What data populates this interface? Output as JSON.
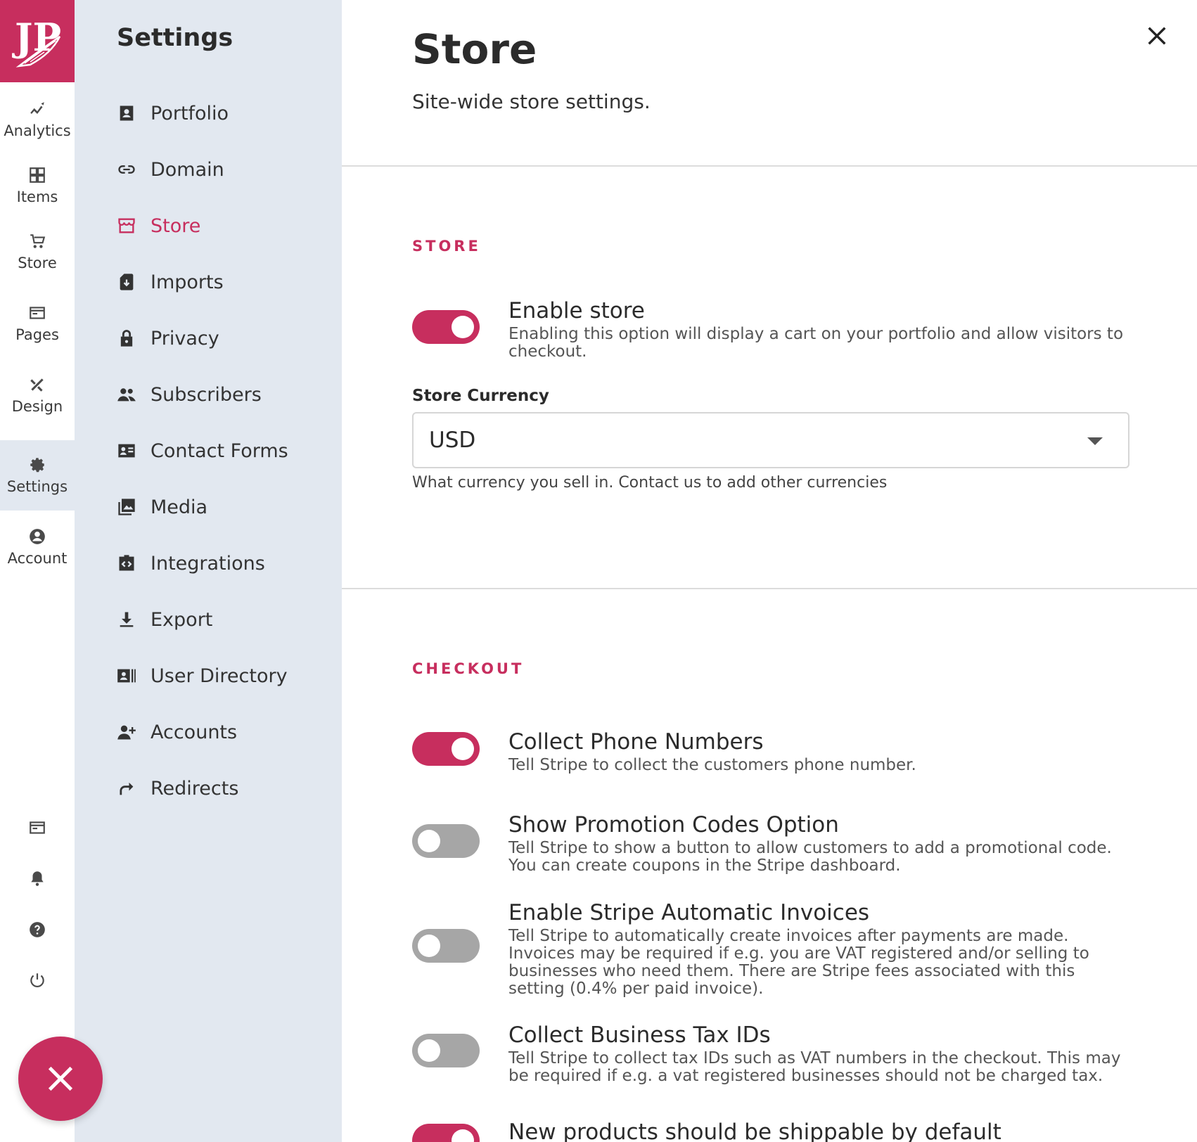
{
  "brand": {
    "accent": "#c72e5e",
    "logo_text": "JP"
  },
  "rail": {
    "items": [
      {
        "label": "Analytics",
        "icon": "analytics-icon"
      },
      {
        "label": "Items",
        "icon": "grid-icon"
      },
      {
        "label": "Store",
        "icon": "cart-icon"
      },
      {
        "label": "Pages",
        "icon": "pages-icon"
      },
      {
        "label": "Design",
        "icon": "design-icon"
      },
      {
        "label": "Settings",
        "icon": "gear-icon",
        "active": true
      },
      {
        "label": "Account",
        "icon": "account-icon"
      }
    ],
    "bottom_icons": [
      "browser-icon",
      "bell-icon",
      "help-icon",
      "power-icon"
    ],
    "fab_icon": "close-icon"
  },
  "sidebar": {
    "title": "Settings",
    "items": [
      {
        "label": "Portfolio",
        "icon": "portfolio-icon"
      },
      {
        "label": "Domain",
        "icon": "link-icon"
      },
      {
        "label": "Store",
        "icon": "store-icon",
        "active": true
      },
      {
        "label": "Imports",
        "icon": "import-icon"
      },
      {
        "label": "Privacy",
        "icon": "lock-icon"
      },
      {
        "label": "Subscribers",
        "icon": "people-icon"
      },
      {
        "label": "Contact Forms",
        "icon": "contact-card-icon"
      },
      {
        "label": "Media",
        "icon": "image-icon"
      },
      {
        "label": "Integrations",
        "icon": "code-icon"
      },
      {
        "label": "Export",
        "icon": "download-icon"
      },
      {
        "label": "User Directory",
        "icon": "directory-icon"
      },
      {
        "label": "Accounts",
        "icon": "add-user-icon"
      },
      {
        "label": "Redirects",
        "icon": "redirect-icon"
      }
    ]
  },
  "main": {
    "title": "Store",
    "subtitle": "Site-wide store settings.",
    "store_section": {
      "heading": "STORE",
      "enable_store": {
        "title": "Enable store",
        "description": "Enabling this option will display a cart on your portfolio and allow visitors to checkout.",
        "on": true
      },
      "currency": {
        "label": "Store Currency",
        "value": "USD",
        "help": "What currency you sell in. Contact us to add other currencies"
      }
    },
    "checkout_section": {
      "heading": "CHECKOUT",
      "options": [
        {
          "title": "Collect Phone Numbers",
          "description": "Tell Stripe to collect the customers phone number.",
          "on": true
        },
        {
          "title": "Show Promotion Codes Option",
          "description": "Tell Stripe to show a button to allow customers to add a promotional code. You can create coupons in the Stripe dashboard.",
          "on": false
        },
        {
          "title": "Enable Stripe Automatic Invoices",
          "description": "Tell Stripe to automatically create invoices after payments are made. Invoices may be required if e.g. you are VAT registered and/or selling to businesses who need them. There are Stripe fees associated with this setting (0.4% per paid invoice).",
          "on": false
        },
        {
          "title": "Collect Business Tax IDs",
          "description": "Tell Stripe to collect tax IDs such as VAT numbers in the checkout. This may be required if e.g. a vat registered businesses should not be charged tax.",
          "on": false
        },
        {
          "title": "New products should be shippable by default",
          "description": "",
          "on": true
        }
      ]
    }
  }
}
